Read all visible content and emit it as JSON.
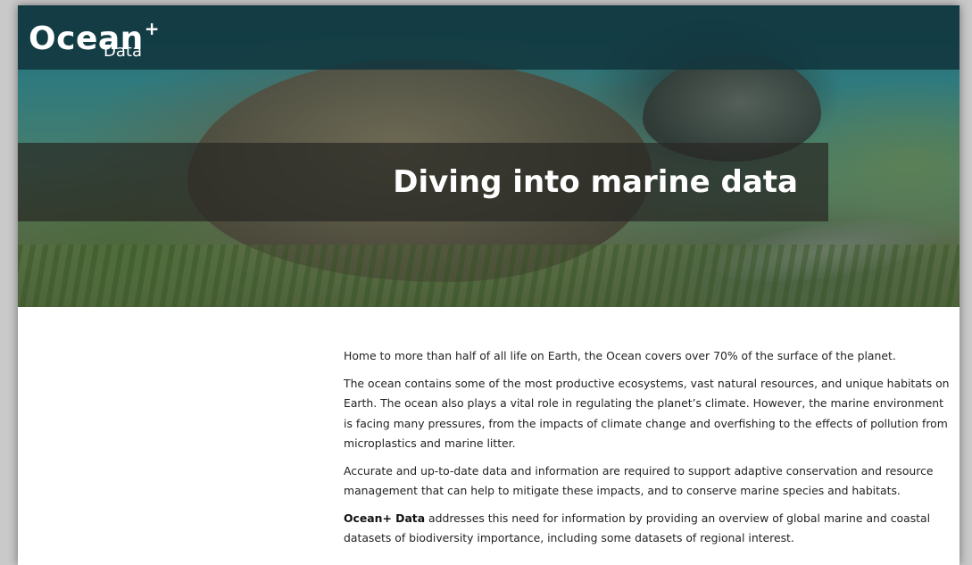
{
  "brand": {
    "name": "Ocean",
    "plus": "+",
    "sub": "Data"
  },
  "hero": {
    "title": "Diving into marine data"
  },
  "content": {
    "paragraphs": [
      "Home to more than half of all life on Earth, the Ocean covers over 70% of the surface of the planet.",
      "The ocean contains some of the most productive ecosystems, vast natural resources, and unique habitats on Earth. The ocean also plays a vital role in regulating the planet’s climate. However, the marine environment is facing many pressures, from the impacts of climate change and overfishing to the effects of pollution from microplastics and marine litter.",
      "Accurate and up-to-date data and information are required to support adaptive conservation and resource management that can help to mitigate these impacts, and to conserve marine species and habitats."
    ],
    "last": {
      "bold": "Ocean+ Data",
      "rest": " addresses this need for information by providing an overview of global marine and coastal datasets of biodiversity importance, including some datasets of regional interest."
    }
  },
  "colors": {
    "brand_bar": "#11363e",
    "title_band": "#282824",
    "text": "#222222",
    "background": "#ffffff"
  }
}
